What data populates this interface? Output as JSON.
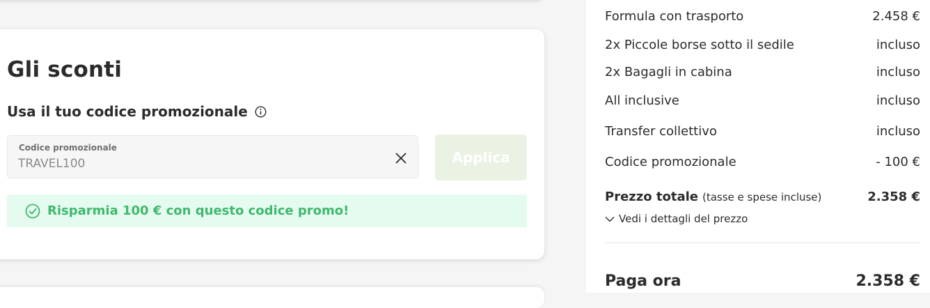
{
  "discounts": {
    "title": "Gli sconti",
    "promo_heading": "Usa il tuo codice promozionale",
    "field_label": "Codice promozionale",
    "field_value": "TRAVEL100",
    "apply_label": "Applica",
    "success_message": "Risparmia 100 € con questo codice promo!"
  },
  "summary": {
    "items": [
      {
        "label": "Formula con trasporto",
        "value": "2.458 €"
      },
      {
        "label": "2x Piccole borse sotto il sedile",
        "value": "incluso"
      },
      {
        "label": "2x Bagagli in cabina",
        "value": "incluso"
      },
      {
        "label": "All inclusive",
        "value": "incluso"
      },
      {
        "label": "Transfer collettivo",
        "value": "incluso"
      },
      {
        "label": "Codice promozionale",
        "value": "- 100 €"
      }
    ],
    "total_label": "Prezzo totale",
    "total_note": "(tasse e spese incluse)",
    "total_value": "2.358 €",
    "details_link": "Vedi i dettagli del prezzo",
    "pay_label": "Paga ora",
    "pay_value": "2.358 €"
  },
  "icons": {
    "info": "info-icon",
    "clear": "close-icon",
    "success": "check-circle-icon",
    "chevron": "chevron-down-icon"
  },
  "colors": {
    "success_text": "#3fb86e",
    "success_bg": "#e6fbef",
    "apply_disabled_bg": "#e9f2e3"
  }
}
